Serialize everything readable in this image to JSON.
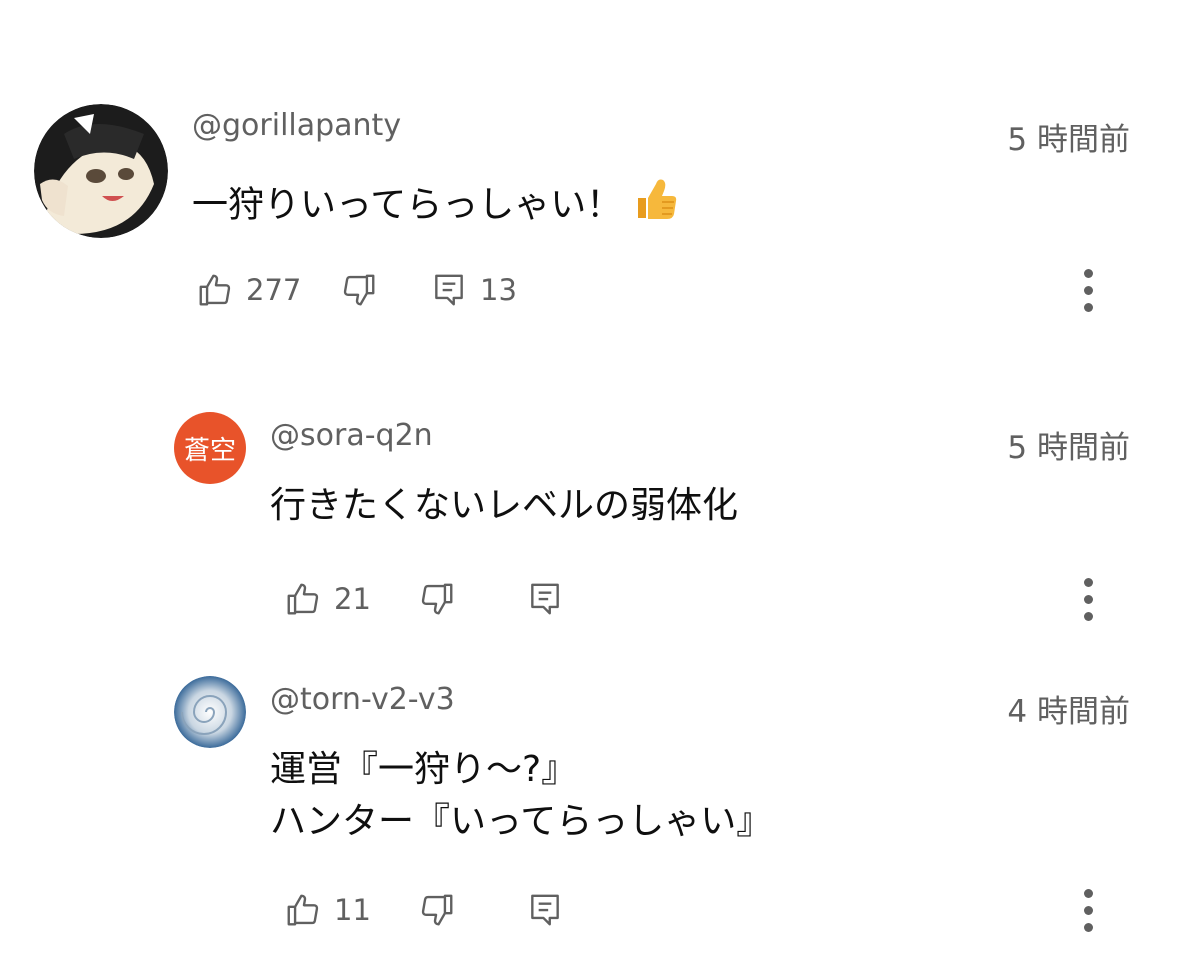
{
  "comments": [
    {
      "handle": "@gorillapanty",
      "time": "5 時間前",
      "text": "一狩りいってらっしゃい！",
      "emoji": "thumbs-up-emoji",
      "likes": "277",
      "replies": "13"
    },
    {
      "handle": "@sora-q2n",
      "time": "5 時間前",
      "avatar_text": "蒼空",
      "avatar_color": "#e8532a",
      "text": "行きたくないレベルの弱体化",
      "likes": "21"
    },
    {
      "handle": "@torn-v2-v3",
      "time": "4 時間前",
      "text_line1": "運営『一狩り〜?』",
      "text_line2": "ハンター『いってらっしゃい』",
      "likes": "11"
    }
  ],
  "icons": {
    "like": "thumbs-up-outline-icon",
    "dislike": "thumbs-down-outline-icon",
    "reply": "comment-icon",
    "more": "more-vert-icon"
  }
}
